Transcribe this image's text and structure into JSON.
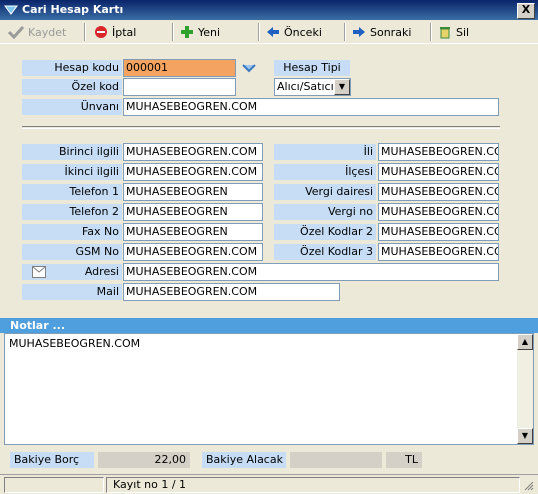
{
  "window": {
    "title": "Cari Hesap Kartı",
    "close": "X"
  },
  "toolbar": {
    "save": "Kaydet",
    "cancel": "İptal",
    "new": "Yeni",
    "prev": "Önceki",
    "next": "Sonraki",
    "delete": "Sil"
  },
  "form": {
    "account_code_label": "Hesap kodu",
    "account_code": "000001",
    "account_type_label": "Hesap Tipi",
    "account_type": "Alıcı/Satıcı",
    "special_code_label": "Özel kod",
    "special_code": "",
    "title_label": "Ünvanı",
    "title": "MUHASEBEOGREN.COM",
    "first_contact_label": "Birinci ilgili",
    "first_contact": "MUHASEBEOGREN.COM",
    "second_contact_label": "İkinci ilgili",
    "second_contact": "MUHASEBEOGREN.COM",
    "phone1_label": "Telefon 1",
    "phone1": "MUHASEBEOGREN",
    "phone2_label": "Telefon 2",
    "phone2": "MUHASEBEOGREN",
    "fax_label": "Fax No",
    "fax": "MUHASEBEOGREN",
    "gsm_label": "GSM No",
    "gsm": "MUHASEBEOGREN.COM",
    "city_label": "İli",
    "city": "MUHASEBEOGREN.COM",
    "district_label": "İlçesi",
    "district": "MUHASEBEOGREN.COM",
    "tax_office_label": "Vergi dairesi",
    "tax_office": "MUHASEBEOGREN.COM",
    "tax_no_label": "Vergi no",
    "tax_no": "MUHASEBEOGREN.COM",
    "special_code2_label": "Özel Kodlar 2",
    "special_code2": "MUHASEBEOGREN.COM",
    "special_code3_label": "Özel Kodlar 3",
    "special_code3": "MUHASEBEOGREN.COM",
    "address_label": "Adresi",
    "address": "MUHASEBEOGREN.COM",
    "mail_label": "Mail",
    "mail": "MUHASEBEOGREN.COM"
  },
  "notes": {
    "header": "Notlar ...",
    "text": "MUHASEBEOGREN.COM"
  },
  "balance": {
    "debit_label": "Bakiye Borç",
    "debit": "22,00",
    "credit_label": "Bakiye Alacak",
    "credit": "",
    "currency": "TL"
  },
  "status": {
    "record": "Kayıt no 1 / 1"
  }
}
